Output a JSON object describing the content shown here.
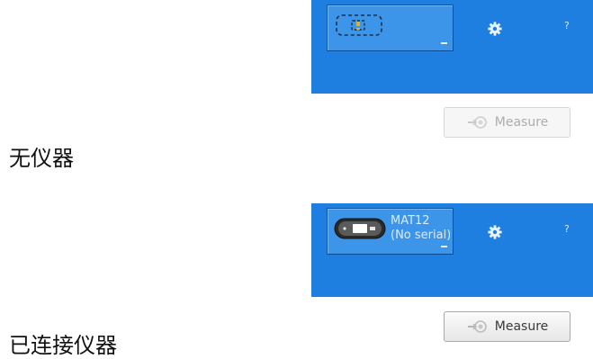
{
  "state_no_device": {
    "caption": "无仪器",
    "measure_label": "Measure",
    "help_label": "?",
    "device_icon": "missing-device-dashed-icon"
  },
  "state_connected": {
    "caption": "已连接仪器",
    "device_name": "MAT12",
    "device_serial": "(No serial)",
    "measure_label": "Measure",
    "help_label": "?",
    "device_icon": "instrument-device-icon"
  },
  "icons": {
    "settings": "gear-icon",
    "measure": "measure-probe-icon",
    "dropdown": "dropdown-arrow-icon"
  },
  "colors": {
    "toolbar_bg": "#1f7fe0",
    "device_button_bg": "#3d95ea",
    "missing_device_accent": "#d1b04b"
  }
}
